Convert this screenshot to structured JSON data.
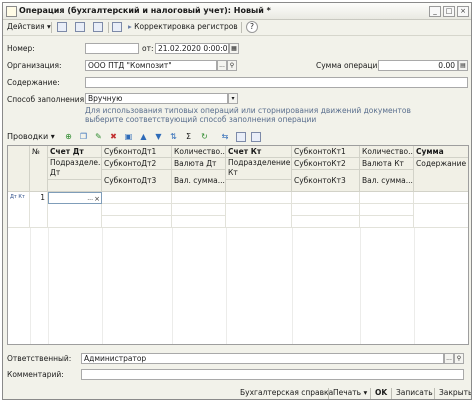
{
  "window": {
    "title": "Операция (бухгалтерский и налоговый учет): Новый *"
  },
  "toolbar": {
    "actions_label": "Действия",
    "registers_label": "Корректировка регистров",
    "help_label": "?"
  },
  "form": {
    "number_label": "Номер:",
    "number_value": "",
    "date_label": "от:",
    "date_value": "21.02.2020  0:00:00",
    "org_label": "Организация:",
    "org_value": "ООО ПТД \"Композит\"",
    "sum_label": "Сумма операции:",
    "sum_value": "0.00",
    "content_label": "Содержание:",
    "content_value": "",
    "fill_label": "Способ заполнения:",
    "fill_value": "Вручную",
    "fill_hint_line1": "Для использования типовых операций или сторнирования движений документов",
    "fill_hint_line2": "выберите соответствующий способ заполнения операции"
  },
  "entries": {
    "menu_label": "Проводки",
    "dtkt_icon_label": "Дт Кт"
  },
  "grid": {
    "headers": {
      "r1": [
        "№",
        "Счет Дт",
        "СубконтоДт1",
        "Количество...",
        "Счет Кт",
        "СубконтоКт1",
        "Количество...",
        "Сумма"
      ],
      "r2": [
        "Подразделе... Дт",
        "СубконтоДт2",
        "Валюта Дт",
        "Подразделение Кт",
        "СубконтоКт2",
        "Валюта Кт",
        "Содержание"
      ],
      "r3": [
        "СубконтоДт3",
        "Вал. сумма...",
        "СубконтоКт3",
        "Вал. сумма..."
      ]
    },
    "row": {
      "number": "1",
      "debit_account": ""
    }
  },
  "footer": {
    "responsible_label": "Ответственный:",
    "responsible_value": "Администратор",
    "comment_label": "Комментарий:",
    "comment_value": ""
  },
  "bottom": {
    "report_label": "Бухгалтерская справка",
    "print_label": "Печать",
    "ok_label": "OK",
    "save_label": "Записать",
    "close_label": "Закрыть"
  }
}
